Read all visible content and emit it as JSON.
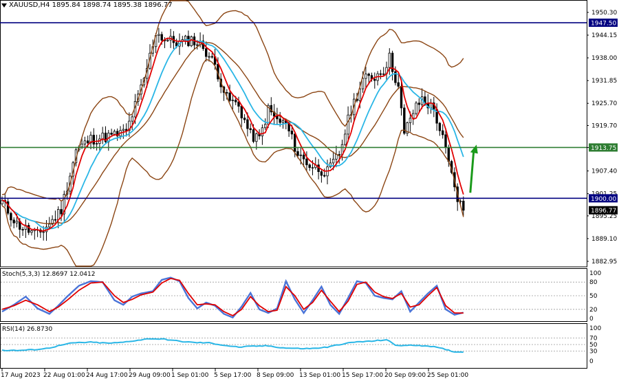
{
  "window": {
    "symbol_line": "XAUUSD,H4  1895.84 1898.74 1895.38 1896.77"
  },
  "colors": {
    "candle": "#000000",
    "bollinger": "#8B4513",
    "ma_fast": "#e00000",
    "ma_slow": "#29b6e6",
    "hline_blue": "#000080",
    "hline_green": "#2e7d32",
    "arrow": "#1a9a1a",
    "stoch_k": "#4a74d8",
    "stoch_d": "#e00000",
    "rsi": "#29b6e6"
  },
  "chart_data": [
    {
      "type": "line",
      "panel": "price",
      "title": "XAUUSD,H4",
      "ylim": [
        1881.5,
        1955.5
      ],
      "y_ticks": [
        "1950.30",
        "1944.15",
        "1938.00",
        "1931.85",
        "1925.70",
        "1919.70",
        "1913.75",
        "1907.40",
        "1901.25",
        "1895.25",
        "1889.10",
        "1882.95"
      ],
      "x_labels": [
        "17 Aug 2023",
        "22 Aug 01:00",
        "24 Aug 17:00",
        "29 Aug 09:00",
        "1 Sep 01:00",
        "5 Sep 17:00",
        "8 Sep 09:00",
        "13 Sep 01:00",
        "15 Sep 17:00",
        "20 Sep 09:00",
        "25 Sep 01:00"
      ],
      "hlines": [
        {
          "value": 1947.5,
          "label": "1947.50",
          "color": "#000080"
        },
        {
          "value": 1913.75,
          "label": "1913.75",
          "color": "#2e7d32"
        },
        {
          "value": 1900.0,
          "label": "1900.00",
          "color": "#000080"
        }
      ],
      "last_price": {
        "value": 1896.77,
        "label": "1896.77"
      },
      "close_key": [
        [
          0,
          1899
        ],
        [
          5,
          1893
        ],
        [
          12,
          1890
        ],
        [
          17,
          1894
        ],
        [
          20,
          1897
        ],
        [
          25,
          1913
        ],
        [
          30,
          1916
        ],
        [
          38,
          1917
        ],
        [
          42,
          1918
        ],
        [
          48,
          1932
        ],
        [
          52,
          1945
        ],
        [
          55,
          1943
        ],
        [
          60,
          1942
        ],
        [
          64,
          1943
        ],
        [
          68,
          1941
        ],
        [
          72,
          1936
        ],
        [
          76,
          1927
        ],
        [
          80,
          1925
        ],
        [
          84,
          1917
        ],
        [
          87,
          1916
        ],
        [
          90,
          1924
        ],
        [
          93,
          1921
        ],
        [
          96,
          1920
        ],
        [
          100,
          1912
        ],
        [
          104,
          1909
        ],
        [
          110,
          1907
        ],
        [
          114,
          1912
        ],
        [
          118,
          1924
        ],
        [
          122,
          1932
        ],
        [
          126,
          1933
        ],
        [
          129,
          1935
        ],
        [
          131,
          1938
        ],
        [
          134,
          1930
        ],
        [
          136,
          1917
        ],
        [
          138,
          1922
        ],
        [
          142,
          1927
        ],
        [
          146,
          1924
        ],
        [
          149,
          1916
        ],
        [
          152,
          1906
        ],
        [
          154,
          1900
        ],
        [
          156,
          1897
        ]
      ],
      "series": [
        {
          "name": "Bollinger Bands"
        },
        {
          "name": "MA fast"
        },
        {
          "name": "MA slow"
        }
      ]
    },
    {
      "type": "line",
      "panel": "stochastic",
      "title": "Stoch(5,3,3) 12.8697 12.0412",
      "ylim": [
        0,
        100
      ],
      "y_ticks": [
        "100",
        "80",
        "50",
        "20",
        "0"
      ],
      "levels": [
        20,
        50,
        80
      ],
      "k_key": [
        [
          0,
          15
        ],
        [
          4,
          30
        ],
        [
          8,
          48
        ],
        [
          12,
          22
        ],
        [
          16,
          10
        ],
        [
          19,
          28
        ],
        [
          22,
          48
        ],
        [
          26,
          72
        ],
        [
          30,
          82
        ],
        [
          34,
          80
        ],
        [
          38,
          40
        ],
        [
          41,
          30
        ],
        [
          44,
          48
        ],
        [
          47,
          55
        ],
        [
          51,
          60
        ],
        [
          54,
          85
        ],
        [
          57,
          90
        ],
        [
          60,
          82
        ],
        [
          63,
          45
        ],
        [
          66,
          22
        ],
        [
          69,
          35
        ],
        [
          72,
          28
        ],
        [
          75,
          10
        ],
        [
          78,
          2
        ],
        [
          81,
          26
        ],
        [
          84,
          56
        ],
        [
          87,
          20
        ],
        [
          90,
          12
        ],
        [
          93,
          22
        ],
        [
          96,
          82
        ],
        [
          99,
          42
        ],
        [
          102,
          12
        ],
        [
          105,
          40
        ],
        [
          108,
          70
        ],
        [
          111,
          30
        ],
        [
          114,
          10
        ],
        [
          117,
          45
        ],
        [
          120,
          82
        ],
        [
          123,
          78
        ],
        [
          126,
          50
        ],
        [
          129,
          45
        ],
        [
          132,
          42
        ],
        [
          135,
          60
        ],
        [
          138,
          15
        ],
        [
          141,
          35
        ],
        [
          144,
          55
        ],
        [
          147,
          72
        ],
        [
          150,
          20
        ],
        [
          153,
          8
        ],
        [
          156,
          12.87
        ]
      ],
      "d_key": [
        [
          0,
          20
        ],
        [
          4,
          28
        ],
        [
          8,
          40
        ],
        [
          12,
          30
        ],
        [
          16,
          15
        ],
        [
          19,
          25
        ],
        [
          22,
          40
        ],
        [
          26,
          62
        ],
        [
          30,
          78
        ],
        [
          34,
          80
        ],
        [
          38,
          50
        ],
        [
          41,
          35
        ],
        [
          44,
          42
        ],
        [
          47,
          52
        ],
        [
          51,
          58
        ],
        [
          54,
          78
        ],
        [
          57,
          88
        ],
        [
          60,
          84
        ],
        [
          63,
          55
        ],
        [
          66,
          30
        ],
        [
          69,
          32
        ],
        [
          72,
          30
        ],
        [
          75,
          15
        ],
        [
          78,
          6
        ],
        [
          81,
          20
        ],
        [
          84,
          48
        ],
        [
          87,
          28
        ],
        [
          90,
          15
        ],
        [
          93,
          18
        ],
        [
          96,
          70
        ],
        [
          99,
          50
        ],
        [
          102,
          20
        ],
        [
          105,
          35
        ],
        [
          108,
          62
        ],
        [
          111,
          38
        ],
        [
          114,
          15
        ],
        [
          117,
          38
        ],
        [
          120,
          75
        ],
        [
          123,
          80
        ],
        [
          126,
          58
        ],
        [
          129,
          48
        ],
        [
          132,
          44
        ],
        [
          135,
          55
        ],
        [
          138,
          25
        ],
        [
          141,
          30
        ],
        [
          144,
          50
        ],
        [
          147,
          68
        ],
        [
          150,
          28
        ],
        [
          153,
          12
        ],
        [
          156,
          12.04
        ]
      ]
    },
    {
      "type": "line",
      "panel": "rsi",
      "title": "RSI(14) 26.8730",
      "ylim": [
        0,
        100
      ],
      "y_ticks": [
        "100",
        "70",
        "50",
        "30",
        "0"
      ],
      "levels": [
        30,
        50,
        70
      ],
      "values_key": [
        [
          0,
          33
        ],
        [
          5,
          32
        ],
        [
          10,
          34
        ],
        [
          15,
          38
        ],
        [
          20,
          48
        ],
        [
          24,
          55
        ],
        [
          30,
          57
        ],
        [
          36,
          54
        ],
        [
          40,
          56
        ],
        [
          45,
          62
        ],
        [
          50,
          68
        ],
        [
          55,
          66
        ],
        [
          60,
          60
        ],
        [
          65,
          56
        ],
        [
          70,
          55
        ],
        [
          75,
          48
        ],
        [
          80,
          42
        ],
        [
          85,
          45
        ],
        [
          90,
          46
        ],
        [
          95,
          40
        ],
        [
          100,
          38
        ],
        [
          105,
          38
        ],
        [
          110,
          42
        ],
        [
          115,
          52
        ],
        [
          120,
          58
        ],
        [
          125,
          60
        ],
        [
          130,
          65
        ],
        [
          133,
          48
        ],
        [
          136,
          47
        ],
        [
          140,
          48
        ],
        [
          145,
          45
        ],
        [
          150,
          35
        ],
        [
          153,
          28
        ],
        [
          156,
          26.87
        ]
      ]
    }
  ]
}
